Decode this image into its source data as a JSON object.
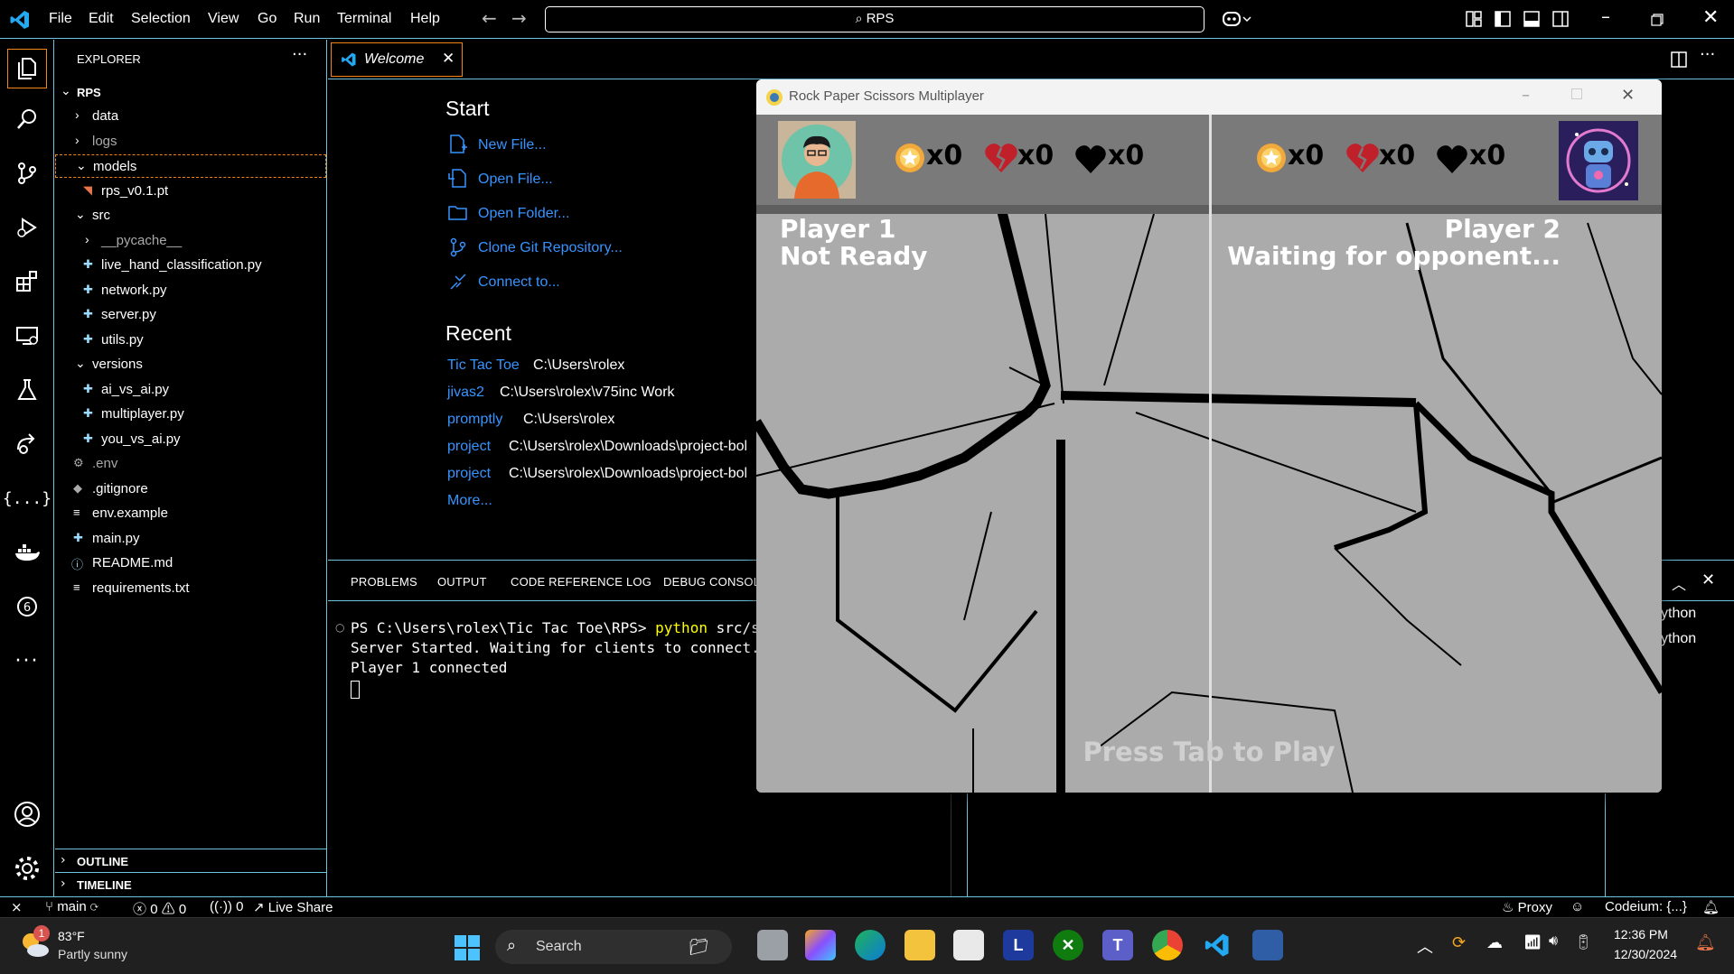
{
  "menu": [
    "File",
    "Edit",
    "Selection",
    "View",
    "Go",
    "Run",
    "Terminal",
    "Help"
  ],
  "search": {
    "text": "RPS"
  },
  "explorer": {
    "header": "EXPLORER",
    "root": "RPS",
    "items": [
      {
        "label": "data",
        "type": "folder",
        "state": "collapsed"
      },
      {
        "label": "logs",
        "type": "folder",
        "state": "collapsed"
      },
      {
        "label": "models",
        "type": "folder",
        "state": "expanded"
      },
      {
        "label": "rps_v0.1.pt",
        "type": "file"
      },
      {
        "label": "src",
        "type": "folder",
        "state": "expanded"
      },
      {
        "label": "__pycache__",
        "type": "folder",
        "state": "collapsed"
      },
      {
        "label": "live_hand_classification.py",
        "type": "python"
      },
      {
        "label": "network.py",
        "type": "python"
      },
      {
        "label": "server.py",
        "type": "python"
      },
      {
        "label": "utils.py",
        "type": "python"
      },
      {
        "label": "versions",
        "type": "folder",
        "state": "expanded"
      },
      {
        "label": "ai_vs_ai.py",
        "type": "python"
      },
      {
        "label": "multiplayer.py",
        "type": "python"
      },
      {
        "label": "you_vs_ai.py",
        "type": "python"
      },
      {
        "label": ".env",
        "type": "gear"
      },
      {
        "label": ".gitignore",
        "type": "git"
      },
      {
        "label": "env.example",
        "type": "text"
      },
      {
        "label": "main.py",
        "type": "python"
      },
      {
        "label": "README.md",
        "type": "info"
      },
      {
        "label": "requirements.txt",
        "type": "text"
      }
    ],
    "outline": "OUTLINE",
    "timeline": "TIMELINE"
  },
  "editor": {
    "tab_label": "Welcome",
    "start_heading": "Start",
    "start_links": [
      "New File...",
      "Open File...",
      "Open Folder...",
      "Clone Git Repository...",
      "Connect to..."
    ],
    "recent_heading": "Recent",
    "recent": [
      {
        "name": "Tic Tac Toe",
        "path": "C:\\Users\\rolex"
      },
      {
        "name": "jivas2",
        "path": "C:\\Users\\rolex\\v75inc Work"
      },
      {
        "name": "promptly",
        "path": "C:\\Users\\rolex"
      },
      {
        "name": "project",
        "path": "C:\\Users\\rolex\\Downloads\\project-bol"
      },
      {
        "name": "project",
        "path": "C:\\Users\\rolex\\Downloads\\project-bol"
      }
    ],
    "more": "More..."
  },
  "panel": {
    "tabs": [
      "PROBLEMS",
      "OUTPUT",
      "CODE REFERENCE LOG",
      "DEBUG CONSOLE"
    ],
    "terminal": {
      "prompt": "PS C:\\Users\\rolex\\Tic Tac Toe\\RPS> ",
      "command": "python",
      "args": " src/serv",
      "lines": [
        "Server Started. Waiting for clients to connect...",
        "Player 1 connected"
      ]
    },
    "terminal_list": [
      "ython",
      "ython"
    ]
  },
  "statusbar": {
    "branch": "main",
    "errors": "0",
    "warnings": "0",
    "ports": "0",
    "live_share": "Live Share",
    "proxy": "Proxy",
    "codeium": "Codeium: {...}"
  },
  "taskbar": {
    "weather_temp": "83°F",
    "weather_desc": "Partly sunny",
    "weather_badge": "1",
    "search": "Search",
    "time": "12:36 PM",
    "date": "12/30/2024"
  },
  "game": {
    "title": "Rock Paper Scissors Multiplayer",
    "p1": {
      "name": "Player 1",
      "status": "Not Ready",
      "wins": "x0",
      "losses": "x0",
      "ties": "x0"
    },
    "p2": {
      "name": "Player 2",
      "status": "Waiting for opponent...",
      "wins": "x0",
      "losses": "x0",
      "ties": "x0"
    },
    "prompt": "Press Tab to Play"
  },
  "colors": {
    "accent_border": "#6fc3df",
    "link": "#3794ff",
    "active_tab_border": "#f38518",
    "hc_background": "#000000"
  }
}
